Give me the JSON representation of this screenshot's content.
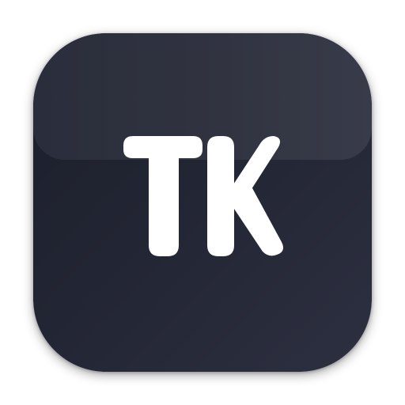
{
  "app_icon": {
    "monogram": "TK",
    "colors": {
      "background_dark": "#1b1e2a",
      "background_light": "#2d3040",
      "gloss": "#353846",
      "letter": "#ffffff"
    }
  }
}
